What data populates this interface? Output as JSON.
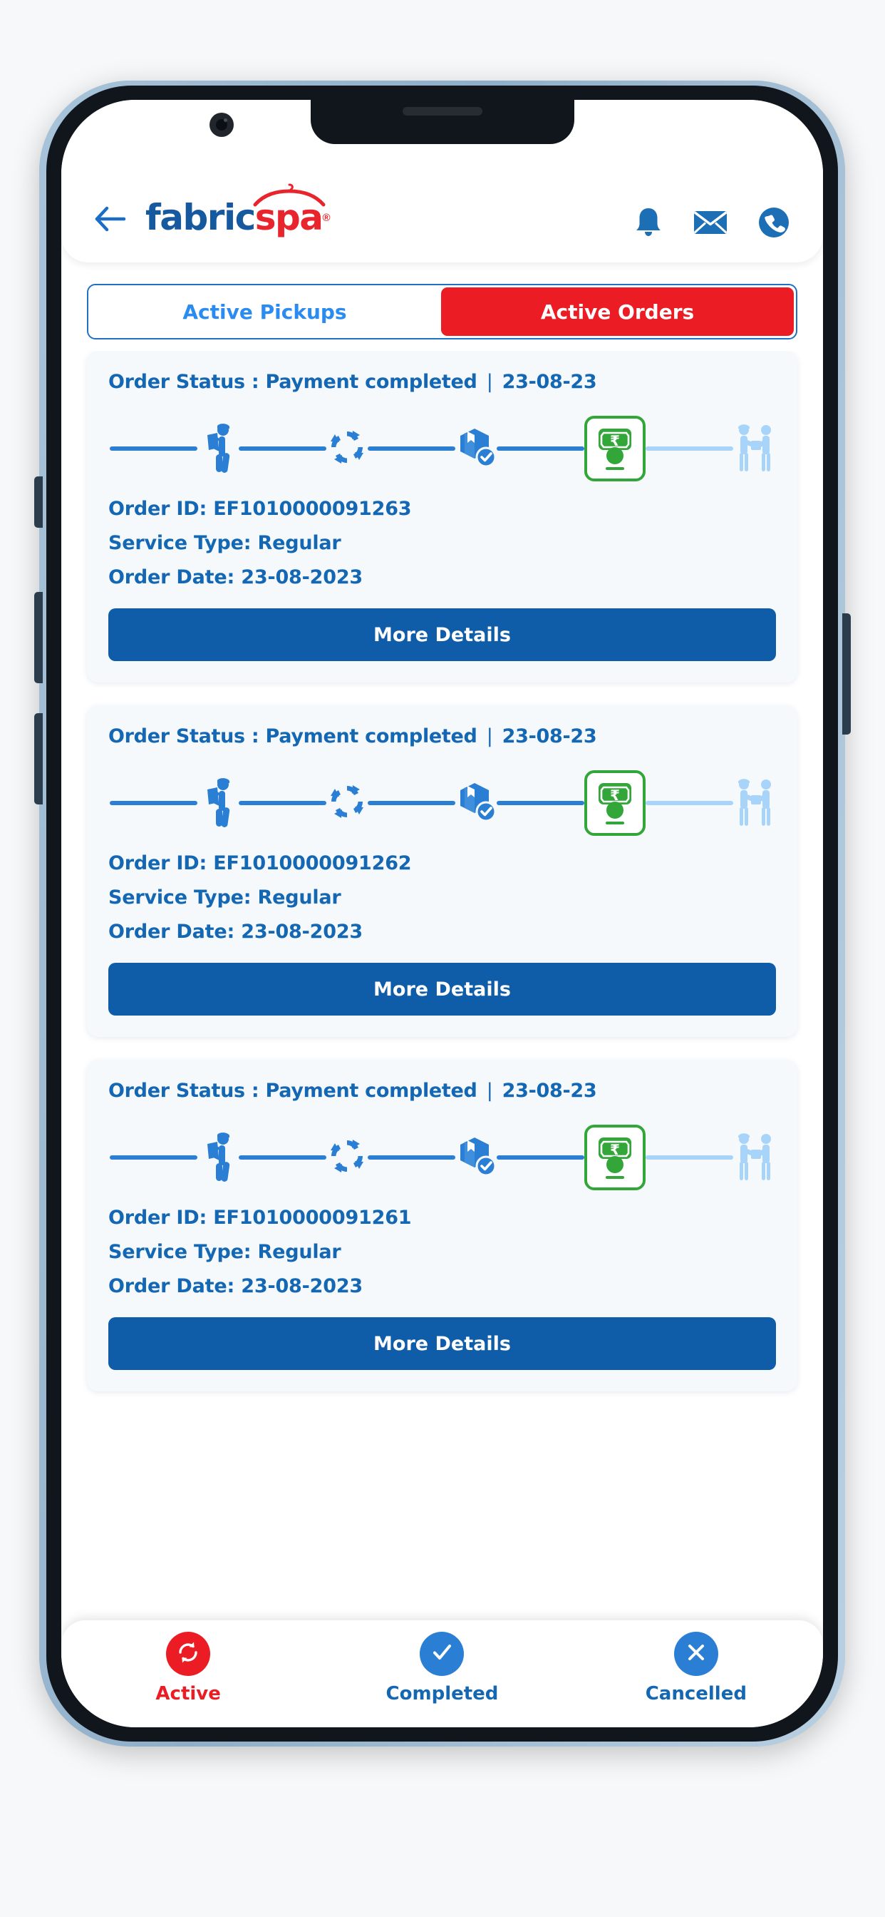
{
  "app": {
    "logo_first": "fabric",
    "logo_second": "spa",
    "logo_registered": "®"
  },
  "header": {
    "back_icon": "arrow-left-icon",
    "icons": [
      {
        "name": "bell-icon",
        "label": "Notifications"
      },
      {
        "name": "envelope-icon",
        "label": "Messages"
      },
      {
        "name": "phone-icon",
        "label": "Call"
      }
    ]
  },
  "tabs": [
    {
      "label": "Active Pickups",
      "active": false
    },
    {
      "label": "Active Orders",
      "active": true
    }
  ],
  "orders": [
    {
      "status_label": "Order Status :",
      "status_value": "Payment completed",
      "status_separator": "|",
      "status_date": "23-08-23",
      "order_id_label": "Order ID:",
      "order_id_value": "EF1010000091263",
      "service_type_label": "Service Type:",
      "service_type_value": "Regular",
      "order_date_label": "Order Date:",
      "order_date_value": "23-08-2023",
      "button_label": "More Details",
      "steps": [
        {
          "name": "pickup-agent-icon",
          "state": "done"
        },
        {
          "name": "processing-icon",
          "state": "done"
        },
        {
          "name": "package-ready-icon",
          "state": "done"
        },
        {
          "name": "payment-icon",
          "state": "current"
        },
        {
          "name": "delivery-handover-icon",
          "state": "pending"
        }
      ]
    },
    {
      "status_label": "Order Status :",
      "status_value": "Payment completed",
      "status_separator": "|",
      "status_date": "23-08-23",
      "order_id_label": "Order ID:",
      "order_id_value": "EF1010000091262",
      "service_type_label": "Service Type:",
      "service_type_value": "Regular",
      "order_date_label": "Order Date:",
      "order_date_value": "23-08-2023",
      "button_label": "More Details",
      "steps": [
        {
          "name": "pickup-agent-icon",
          "state": "done"
        },
        {
          "name": "processing-icon",
          "state": "done"
        },
        {
          "name": "package-ready-icon",
          "state": "done"
        },
        {
          "name": "payment-icon",
          "state": "current"
        },
        {
          "name": "delivery-handover-icon",
          "state": "pending"
        }
      ]
    },
    {
      "status_label": "Order Status :",
      "status_value": "Payment completed",
      "status_separator": "|",
      "status_date": "23-08-23",
      "order_id_label": "Order ID:",
      "order_id_value": "EF1010000091261",
      "service_type_label": "Service Type:",
      "service_type_value": "Regular",
      "order_date_label": "Order Date:",
      "order_date_value": "23-08-2023",
      "button_label": "More Details",
      "steps": [
        {
          "name": "pickup-agent-icon",
          "state": "done"
        },
        {
          "name": "processing-icon",
          "state": "done"
        },
        {
          "name": "package-ready-icon",
          "state": "done"
        },
        {
          "name": "payment-icon",
          "state": "current"
        },
        {
          "name": "delivery-handover-icon",
          "state": "pending"
        }
      ]
    }
  ],
  "bottom_nav": [
    {
      "label": "Active",
      "icon": "refresh-icon",
      "active": true
    },
    {
      "label": "Completed",
      "icon": "check-icon",
      "active": false
    },
    {
      "label": "Cancelled",
      "icon": "close-icon",
      "active": false
    }
  ],
  "colors": {
    "brand_blue": "#16599f",
    "brand_red": "#e8242c",
    "tab_active_bg": "#ec1c24",
    "tab_inactive_text": "#2a8cf0",
    "text_blue": "#1467b3",
    "button_blue": "#0f5ca8",
    "step_active_green": "#33a63a",
    "step_done_blue": "#2a7fd4",
    "step_pending_blue": "#a9d4fa",
    "card_bg": "#f6f9fc",
    "page_bg": "#f7f8f9"
  }
}
